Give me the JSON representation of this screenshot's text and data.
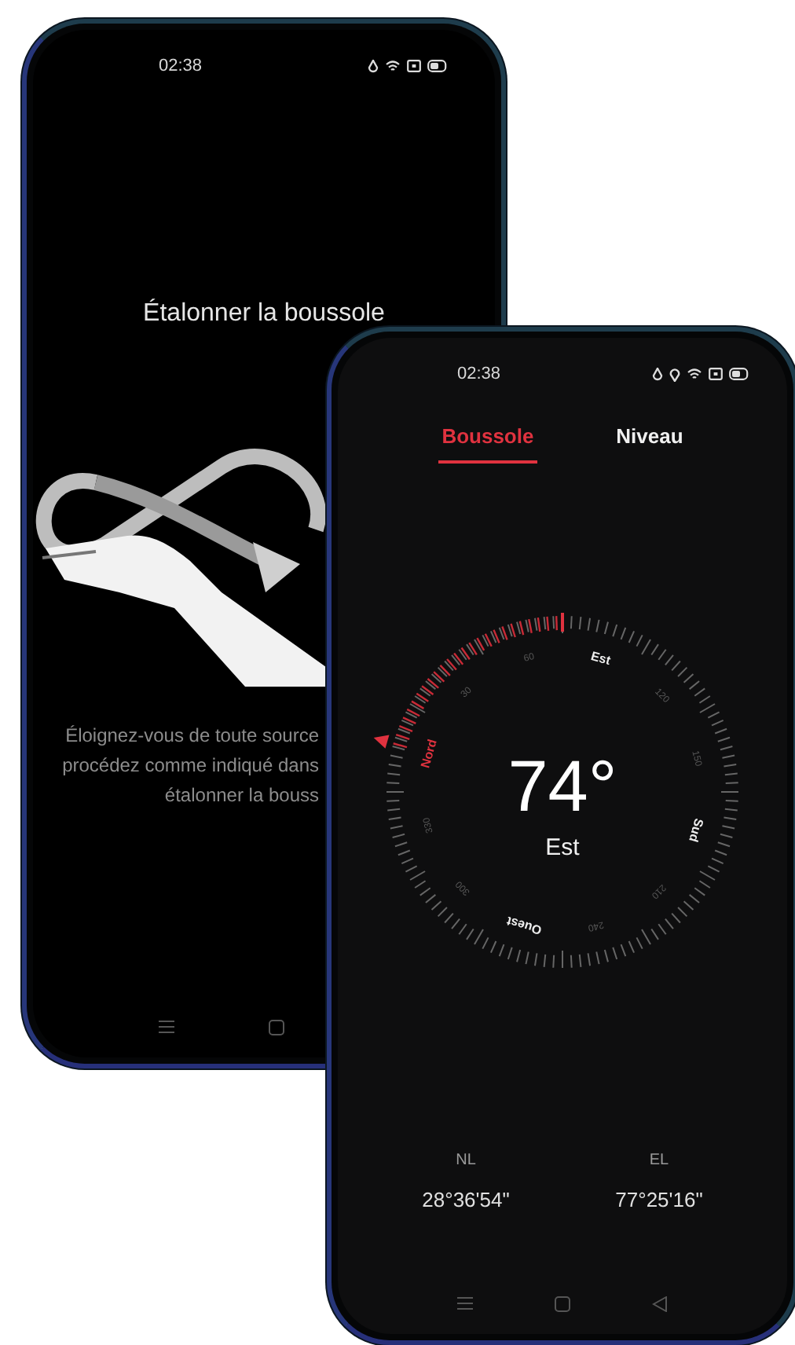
{
  "calibration_screen": {
    "status_bar": {
      "time": "02:38"
    },
    "title": "Étalonner la boussole",
    "instruction": [
      "Éloignez-vous de toute source",
      "procédez comme indiqué dans",
      "étalonner la bouss"
    ]
  },
  "compass_screen": {
    "status_bar": {
      "time": "02:38"
    },
    "tabs": [
      {
        "label": "Boussole",
        "selected": true
      },
      {
        "label": "Niveau",
        "selected": false
      }
    ],
    "heading": "74°",
    "direction": "Est",
    "dial_labels": [
      {
        "text": "Nord",
        "kind": "north"
      },
      {
        "text": "30",
        "kind": "degree"
      },
      {
        "text": "60",
        "kind": "degree"
      },
      {
        "text": "Est",
        "kind": "cardinal"
      },
      {
        "text": "120",
        "kind": "degree"
      },
      {
        "text": "150",
        "kind": "degree"
      },
      {
        "text": "Sud",
        "kind": "cardinal"
      },
      {
        "text": "210",
        "kind": "degree"
      },
      {
        "text": "240",
        "kind": "degree"
      },
      {
        "text": "Ouest",
        "kind": "cardinal"
      },
      {
        "text": "300",
        "kind": "degree"
      },
      {
        "text": "330",
        "kind": "degree"
      }
    ],
    "coordinates": [
      {
        "label": "NL",
        "value": "28°36'54\""
      },
      {
        "label": "EL",
        "value": "77°25'16\""
      }
    ]
  }
}
